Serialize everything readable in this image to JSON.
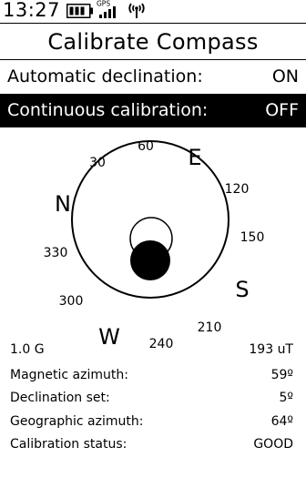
{
  "status_bar": {
    "time": "13:27",
    "gps_label": "GPS",
    "battery_icon": "battery-icon",
    "signal_icon": "signal-bars-icon",
    "antenna_icon": "antenna-icon"
  },
  "title": "Calibrate Compass",
  "settings": [
    {
      "label": "Automatic declination:",
      "value": "ON",
      "selected": false
    },
    {
      "label": "Continuous calibration:",
      "value": "OFF",
      "selected": true
    }
  ],
  "compass": {
    "cardinals": {
      "n": "N",
      "e": "E",
      "s": "S",
      "w": "W"
    },
    "degrees": {
      "d30": "30",
      "d60": "60",
      "d120": "120",
      "d150": "150",
      "d210": "210",
      "d240": "240",
      "d300": "300",
      "d330": "330"
    }
  },
  "readouts": {
    "field_strength": "1.0 G",
    "field_total": "193 uT",
    "magnetic_azimuth_label": "Magnetic azimuth:",
    "magnetic_azimuth_value": "59º",
    "declination_label": "Declination set:",
    "declination_value": "5º",
    "geographic_azimuth_label": "Geographic azimuth:",
    "geographic_azimuth_value": "64º",
    "calibration_label": "Calibration status:",
    "calibration_value": "GOOD"
  },
  "colors": {
    "foreground": "#000000",
    "background": "#ffffff"
  }
}
